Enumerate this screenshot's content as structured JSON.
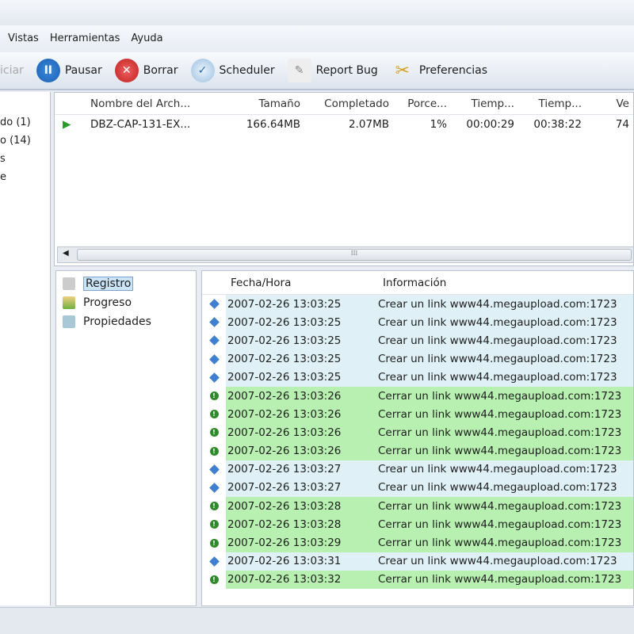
{
  "menu": [
    "Vistas",
    "Herramientas",
    "Ayuda"
  ],
  "toolbar": {
    "iniciar": "iciar",
    "pausar": "Pausar",
    "borrar": "Borrar",
    "scheduler": "Scheduler",
    "report_bug": "Report Bug",
    "preferencias": "Preferencias"
  },
  "sidebar": [
    "do  (1)",
    "o  (14)",
    "s",
    "e"
  ],
  "downloads": {
    "headers": [
      "Nombre del Arch...",
      "Tamaño",
      "Completado",
      "Porce...",
      "Tiemp...",
      "Tiemp...",
      "Ve"
    ],
    "rows": [
      [
        "DBZ-CAP-131-EX...",
        "166.64MB",
        "2.07MB",
        "1%",
        "00:00:29",
        "00:38:22",
        "74"
      ]
    ]
  },
  "tree": [
    "Registro",
    "Progreso",
    "Propiedades"
  ],
  "log": {
    "headers": [
      "Fecha/Hora",
      "Información"
    ],
    "rows": [
      {
        "t": "info",
        "d": "2007-02-26 13:03:25",
        "m": "Crear un link www44.megaupload.com:1723"
      },
      {
        "t": "info",
        "d": "2007-02-26 13:03:25",
        "m": "Crear un link www44.megaupload.com:1723"
      },
      {
        "t": "info",
        "d": "2007-02-26 13:03:25",
        "m": "Crear un link www44.megaupload.com:1723"
      },
      {
        "t": "info",
        "d": "2007-02-26 13:03:25",
        "m": "Crear un link www44.megaupload.com:1723"
      },
      {
        "t": "info",
        "d": "2007-02-26 13:03:25",
        "m": "Crear un link www44.megaupload.com:1723"
      },
      {
        "t": "ok",
        "d": "2007-02-26 13:03:26",
        "m": "Cerrar un link www44.megaupload.com:1723"
      },
      {
        "t": "ok",
        "d": "2007-02-26 13:03:26",
        "m": "Cerrar un link www44.megaupload.com:1723"
      },
      {
        "t": "ok",
        "d": "2007-02-26 13:03:26",
        "m": "Cerrar un link www44.megaupload.com:1723"
      },
      {
        "t": "ok",
        "d": "2007-02-26 13:03:26",
        "m": "Cerrar un link www44.megaupload.com:1723"
      },
      {
        "t": "info",
        "d": "2007-02-26 13:03:27",
        "m": "Crear un link www44.megaupload.com:1723"
      },
      {
        "t": "info",
        "d": "2007-02-26 13:03:27",
        "m": "Crear un link www44.megaupload.com:1723"
      },
      {
        "t": "ok",
        "d": "2007-02-26 13:03:28",
        "m": "Cerrar un link www44.megaupload.com:1723"
      },
      {
        "t": "ok",
        "d": "2007-02-26 13:03:28",
        "m": "Cerrar un link www44.megaupload.com:1723"
      },
      {
        "t": "ok",
        "d": "2007-02-26 13:03:29",
        "m": "Cerrar un link www44.megaupload.com:1723"
      },
      {
        "t": "info",
        "d": "2007-02-26 13:03:31",
        "m": "Crear un link www44.megaupload.com:1723"
      },
      {
        "t": "ok",
        "d": "2007-02-26 13:03:32",
        "m": "Cerrar un link www44.megaupload.com:1723"
      }
    ]
  }
}
